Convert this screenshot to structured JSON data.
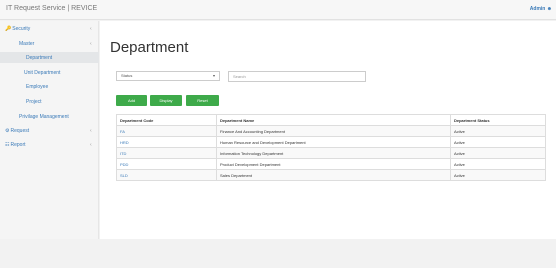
{
  "header": {
    "title": "IT Request Service | REVICE",
    "user": "Admin"
  },
  "sidebar": {
    "items": [
      {
        "label": "Security",
        "icon": "key-icon"
      },
      {
        "label": "Master"
      },
      {
        "label": "Department"
      },
      {
        "label": "Unit Department"
      },
      {
        "label": "Employee"
      },
      {
        "label": "Project"
      },
      {
        "label": "Privilage Management"
      },
      {
        "label": "Request",
        "icon": "gear-icon"
      },
      {
        "label": "Report",
        "icon": "chart-icon"
      }
    ]
  },
  "main": {
    "title": "Department",
    "status_select": "Status",
    "search_placeholder": "Search",
    "buttons": {
      "add": "Add",
      "display": "Display",
      "reset": "Reset"
    },
    "table": {
      "headers": [
        "Department Code",
        "Department Name",
        "Department Status"
      ],
      "rows": [
        [
          "FA",
          "Finance And Accounting Department",
          "Active"
        ],
        [
          "HRD",
          "Human Resource and Development Department",
          "Active"
        ],
        [
          "ITD",
          "Information Technology Department",
          "Active"
        ],
        [
          "PDD",
          "Product Development Department",
          "Active"
        ],
        [
          "SLD",
          "Sales Department",
          "Active"
        ]
      ]
    }
  },
  "colors": {
    "accent": "#3a7ab8",
    "button": "#3eaa4a"
  }
}
